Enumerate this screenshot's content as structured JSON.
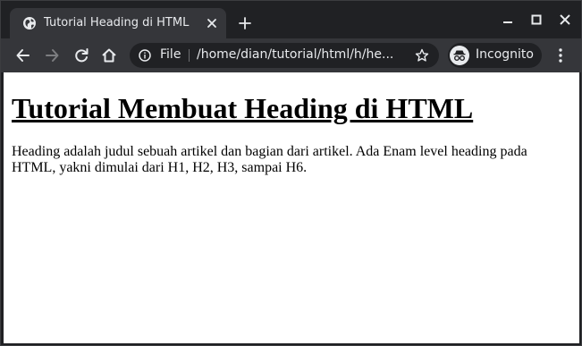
{
  "tab": {
    "title": "Tutorial Heading di HTML",
    "favicon": "globe-icon"
  },
  "window_controls": [
    "minimize-icon",
    "maximize-icon",
    "close-icon"
  ],
  "toolbar": {
    "scheme_label": "File",
    "url": "/home/dian/tutorial/html/h/he...",
    "incognito_label": "Incognito"
  },
  "page": {
    "heading": "Tutorial Membuat Heading di HTML",
    "paragraph": "Heading adalah judul sebuah artikel dan bagian dari artikel. Ada Enam level heading pada HTML, yakni dimulai dari H1, H2, H3, sampai H6."
  },
  "colors": {
    "frame": "#202124",
    "toolbar": "#35363a",
    "text_light": "#e8eaed",
    "page_bg": "#ffffff"
  }
}
